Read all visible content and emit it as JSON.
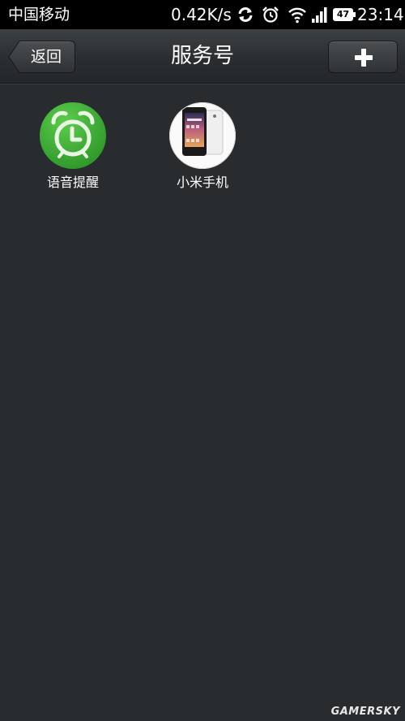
{
  "status_bar": {
    "carrier": "中国移动",
    "network_speed": "0.42K/s",
    "icons": [
      "sync-icon",
      "alarm-icon",
      "wifi-icon",
      "signal-icon",
      "battery-icon"
    ],
    "battery_level": "47",
    "time": "23:14"
  },
  "title_bar": {
    "back_label": "返回",
    "title": "服务号",
    "add_icon": "plus-icon"
  },
  "services": [
    {
      "label": "语音提醒",
      "icon": "alarm-clock-icon",
      "accent": "#3aa535"
    },
    {
      "label": "小米手机",
      "icon": "phone-thumbnail-icon"
    }
  ],
  "watermark": "GAMERSKY",
  "colors": {
    "background": "#292c2e",
    "title_bar": "#2b2e31",
    "status_bar": "#000000"
  }
}
